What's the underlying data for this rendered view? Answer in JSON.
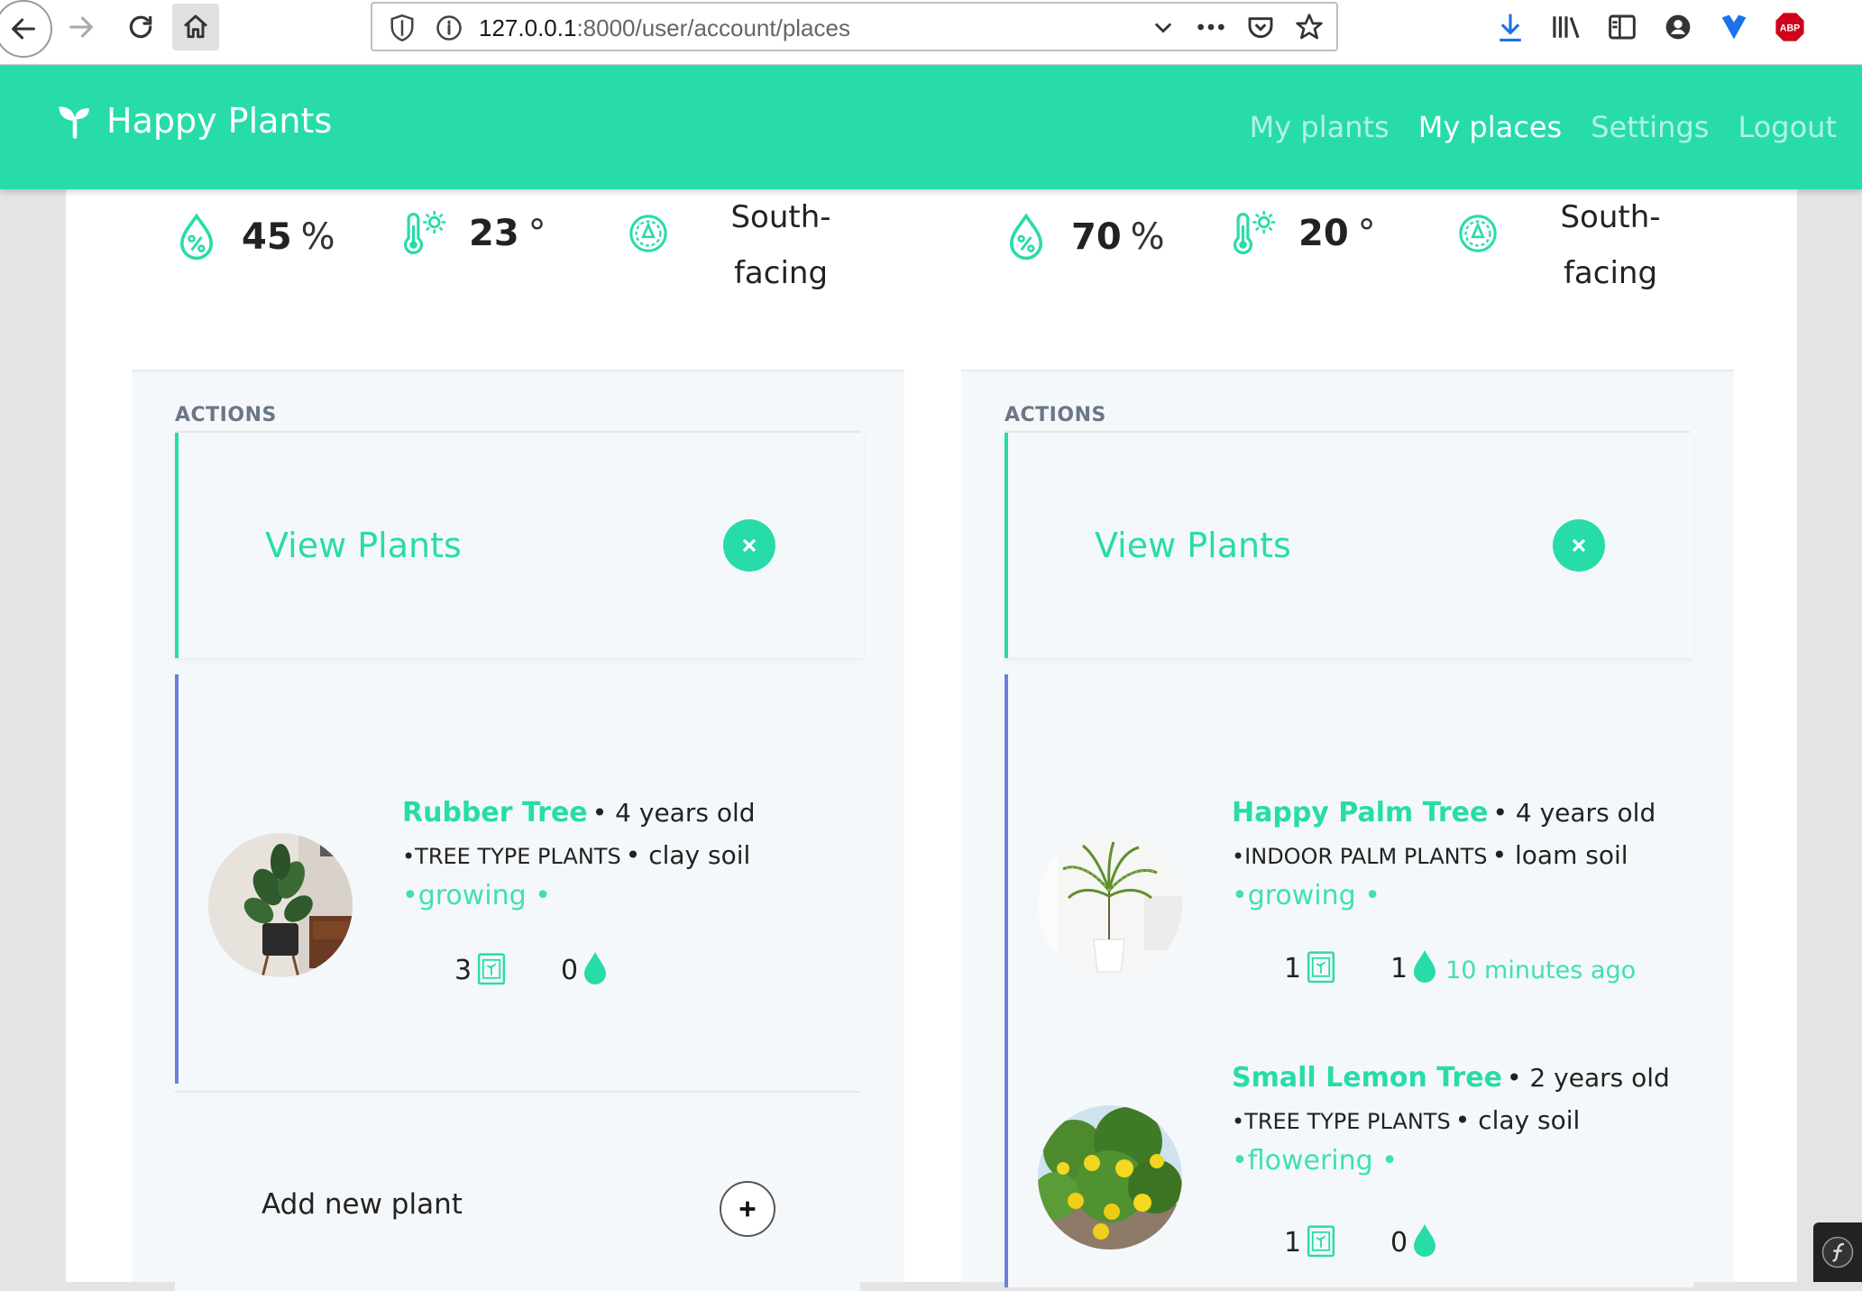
{
  "browser": {
    "url_host": "127.0.0.1",
    "url_path": ":8000/user/account/places"
  },
  "app": {
    "brand": "Happy Plants",
    "accent_color": "#27dca9",
    "nav": [
      {
        "label": "My plants",
        "active": false
      },
      {
        "label": "My places",
        "active": true
      },
      {
        "label": "Settings",
        "active": false
      },
      {
        "label": "Logout",
        "active": false
      }
    ]
  },
  "places": [
    {
      "humidity": "45",
      "humidity_unit": "%",
      "temperature": "23",
      "temperature_unit": "°",
      "orientation_line1": "South-",
      "orientation_line2": "facing",
      "actions_label": "ACTIONS",
      "view_plants_label": "View Plants",
      "plants": [
        {
          "name": "Rubber Tree",
          "age": "• 4 years old",
          "type": "•TREE TYPE PLANTS",
          "soil": "• clay soil",
          "status": "•growing •",
          "fertilizer_count": "3",
          "water_count": "0",
          "last_watered": ""
        }
      ],
      "add_plant_label": "Add new plant"
    },
    {
      "humidity": "70",
      "humidity_unit": "%",
      "temperature": "20",
      "temperature_unit": "°",
      "orientation_line1": "South-",
      "orientation_line2": "facing",
      "actions_label": "ACTIONS",
      "view_plants_label": "View Plants",
      "plants": [
        {
          "name": "Happy Palm Tree",
          "age": "• 4 years old",
          "type": "•INDOOR PALM PLANTS",
          "soil": "• loam soil",
          "status": "•growing •",
          "fertilizer_count": "1",
          "water_count": "1",
          "last_watered": "10 minutes ago"
        },
        {
          "name": "Small Lemon Tree",
          "age": "• 2 years old",
          "type": "•TREE TYPE PLANTS",
          "soil": "• clay soil",
          "status": "•flowering •",
          "fertilizer_count": "1",
          "water_count": "0",
          "last_watered": ""
        }
      ]
    }
  ],
  "icons": {
    "humidity": "humidity-drop-icon",
    "temperature": "thermometer-sun-icon",
    "orientation": "compass-icon",
    "fertilizer": "fertilizer-bag-icon",
    "water": "water-drop-icon"
  }
}
